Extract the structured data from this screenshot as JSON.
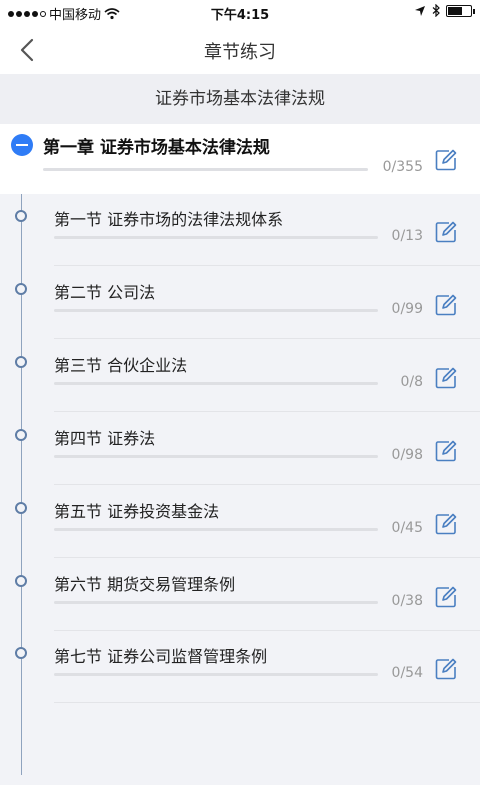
{
  "status_bar": {
    "carrier": "中国移动",
    "time": "下午4:15"
  },
  "nav": {
    "title": "章节练习",
    "back_icon": "chevron-left-icon"
  },
  "subject": {
    "title": "证券市场基本法律法规"
  },
  "chapter": {
    "title": "第一章  证券市场基本法律法规",
    "count": "0/355",
    "progress": 0,
    "toggle_icon": "minus-circle-icon",
    "edit_icon": "edit-icon"
  },
  "sections": [
    {
      "title": "第一节  证券市场的法律法规体系",
      "count": "0/13",
      "progress": 0
    },
    {
      "title": "第二节  公司法",
      "count": "0/99",
      "progress": 0
    },
    {
      "title": "第三节  合伙企业法",
      "count": "0/8",
      "progress": 0
    },
    {
      "title": "第四节  证券法",
      "count": "0/98",
      "progress": 0
    },
    {
      "title": "第五节  证券投资基金法",
      "count": "0/45",
      "progress": 0
    },
    {
      "title": "第六节  期货交易管理条例",
      "count": "0/38",
      "progress": 0
    },
    {
      "title": "第七节  证券公司监督管理条例",
      "count": "0/54",
      "progress": 0
    }
  ],
  "colors": {
    "accent": "#2f7cf6",
    "edit_icon": "#4a7fc1",
    "timeline": "#5f7da6"
  }
}
